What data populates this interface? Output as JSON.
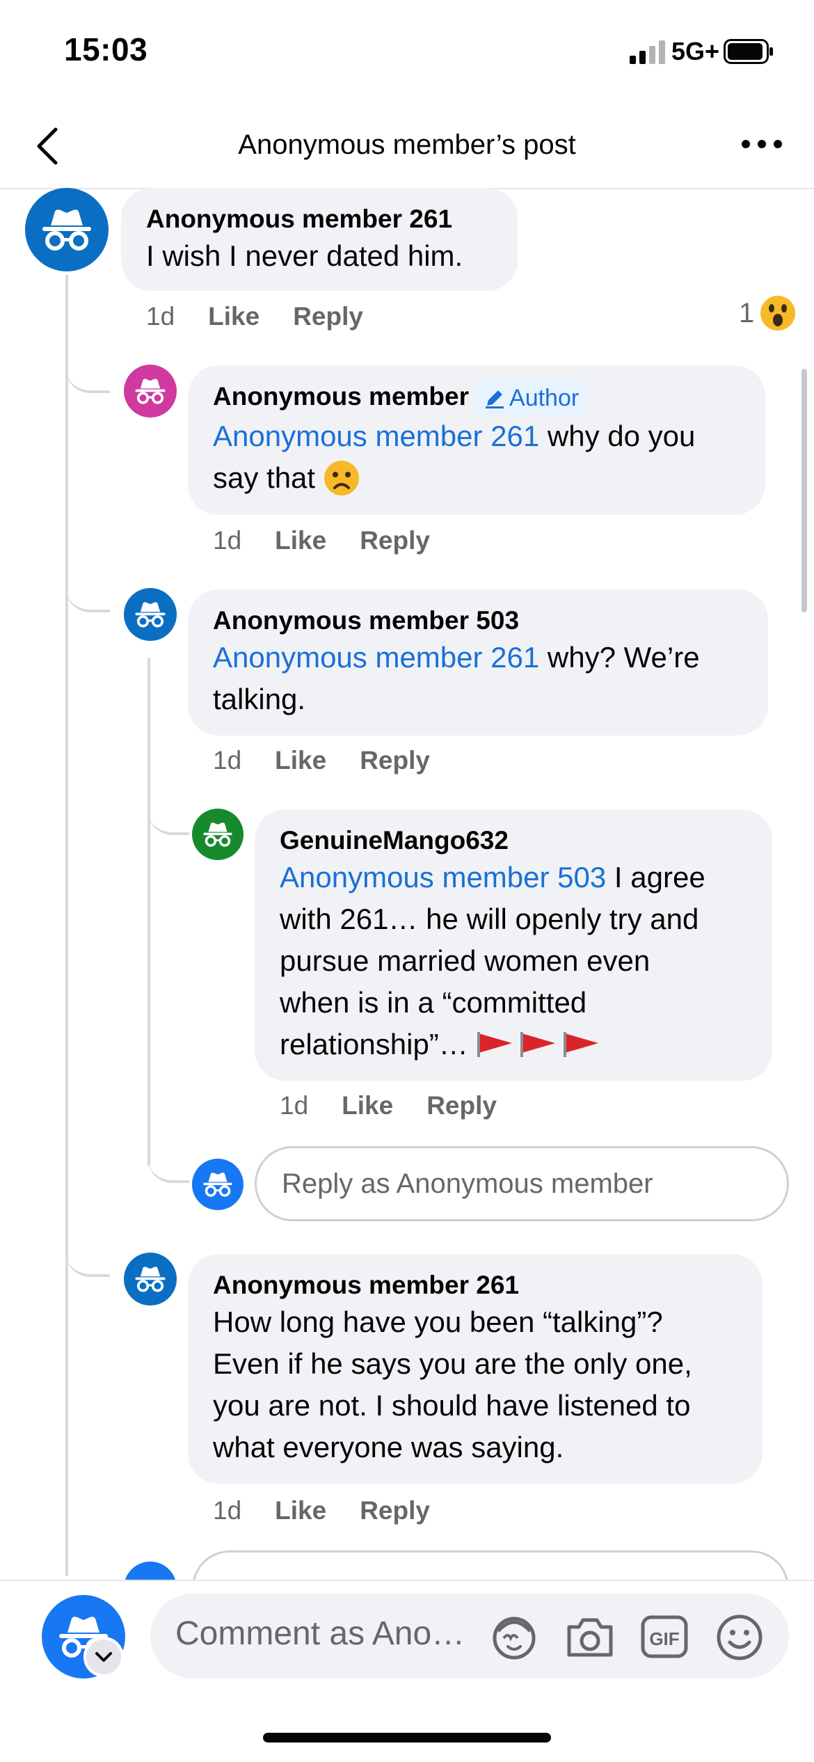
{
  "status_bar": {
    "time": "15:03",
    "network": "5G+"
  },
  "header": {
    "title": "Anonymous member’s post"
  },
  "comments": [
    {
      "author": "Anonymous member 261",
      "text": "I wish I never dated him.",
      "time": "1d",
      "like": "Like",
      "reply": "Reply",
      "reaction_count": "1",
      "reaction_icon": "wow-emoji"
    },
    {
      "author": "Anonymous member",
      "badge": "Author",
      "mention": "Anonymous member 261",
      "text_a": " why do you",
      "text_b": "say that ",
      "time": "1d",
      "like": "Like",
      "reply": "Reply"
    },
    {
      "author": "Anonymous member 503",
      "mention": "Anonymous member 261",
      "text_a": " why? We’re",
      "text_b": "talking.",
      "time": "1d",
      "like": "Like",
      "reply": "Reply"
    },
    {
      "author": "GenuineMango632",
      "mention": "Anonymous member 503",
      "text_a": " I agree",
      "lines": [
        "with 261… he will openly try and",
        "pursue married women even",
        "when is in a “committed",
        "relationship”… "
      ],
      "time": "1d",
      "like": "Like",
      "reply": "Reply"
    },
    {
      "author": "Anonymous member 261",
      "lines": [
        "How long have you been “talking”?",
        "Even if he says you are the only one,",
        "you are not. I should have listened to",
        "what everyone was saying."
      ],
      "time": "1d",
      "like": "Like",
      "reply": "Reply"
    }
  ],
  "reply_box": {
    "placeholder": "Reply as Anonymous member"
  },
  "comment_bar": {
    "placeholder": "Comment as Ano…"
  },
  "colors": {
    "accent": "#1a6fd8",
    "avatar_blue": "#0a6fc2",
    "avatar_pink": "#d0399f",
    "avatar_green": "#178a2e",
    "bubble": "#f0f2f5"
  }
}
